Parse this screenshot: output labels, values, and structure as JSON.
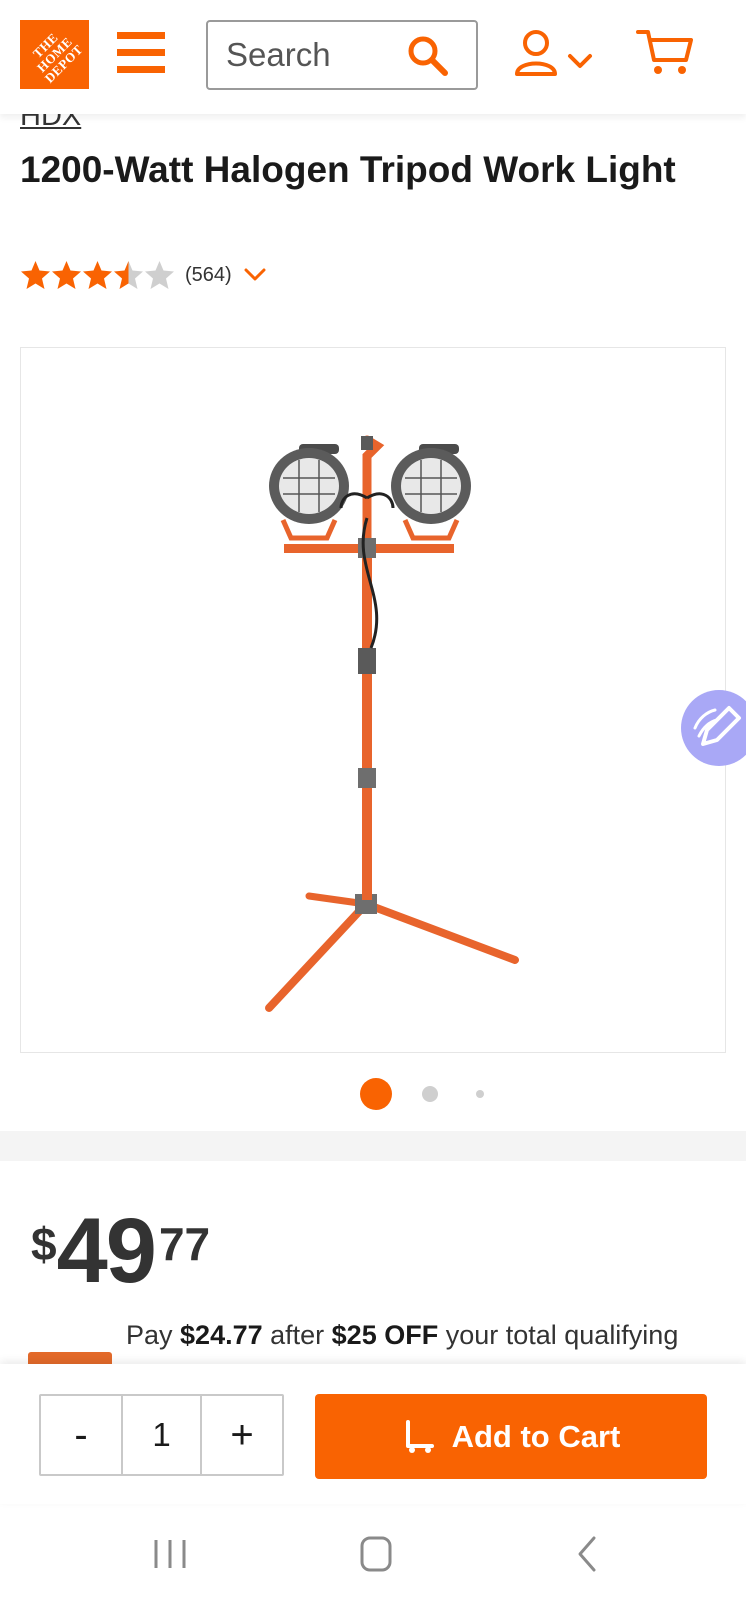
{
  "header": {
    "logo_text": "THE HOME DEPOT",
    "search_placeholder": "Search",
    "icons": [
      "menu-icon",
      "search-icon",
      "user-icon",
      "chevron-down-icon",
      "cart-icon"
    ]
  },
  "product": {
    "brand": "HDX",
    "title": "1200-Watt Halogen Tripod Work Light",
    "rating_value": 3.5,
    "rating_max": 5,
    "review_count": "(564)"
  },
  "gallery": {
    "image_count": 3,
    "active_index": 0
  },
  "pricing": {
    "currency_symbol": "$",
    "whole": "49",
    "cents": "77",
    "promo_pay": "Pay ",
    "promo_amount": "$24.77",
    "promo_after": " after ",
    "promo_discount": "$25 OFF",
    "promo_tail": " your total qualifying"
  },
  "cart_bar": {
    "minus_label": "-",
    "quantity": "1",
    "plus_label": "+",
    "add_label": "Add to Cart"
  },
  "colors": {
    "brand_orange": "#f96302",
    "feedback_purple": "#a9a8f6",
    "star_orange": "#f96302",
    "star_empty": "#cfcfcf"
  }
}
